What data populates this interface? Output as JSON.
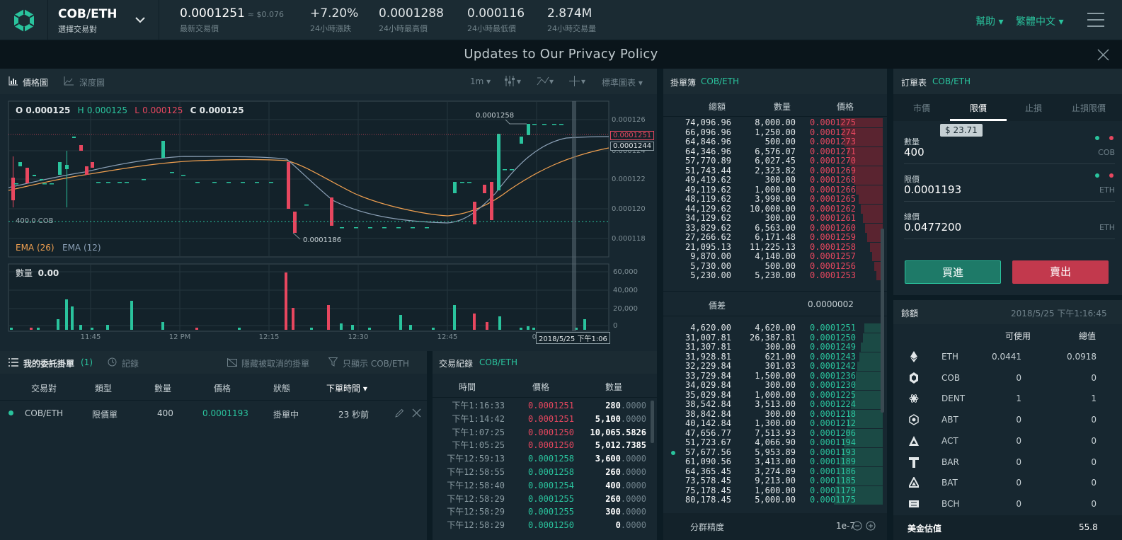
{
  "header": {
    "pair": "COB/ETH",
    "pair_sub": "選擇交易對",
    "last_price": "0.0001251",
    "last_price_usd": "≈ $0.076",
    "last_price_label": "最新交易價",
    "change": "+7.20%",
    "change_label": "24小時漲跌",
    "high": "0.0001288",
    "high_label": "24小時最高價",
    "low": "0.000116",
    "low_label": "24小時最低價",
    "volume": "2.874M",
    "volume_label": "24小時交易量",
    "help": "幫助",
    "language": "繁體中文"
  },
  "banner": {
    "text": "Updates to Our Privacy Policy"
  },
  "chart_panel": {
    "tab_price": "價格圖",
    "tab_depth": "深度圖",
    "interval": "1m",
    "standard": "標準圖表",
    "ohlc": {
      "o_label": "O",
      "o": "0.000125",
      "h_label": "H",
      "h": "0.000125",
      "l_label": "L",
      "l": "0.000125",
      "c_label": "C",
      "c": "0.000125"
    },
    "ema26": "EMA (26)",
    "ema12": "EMA (12)",
    "order_line": "400.0 COB",
    "label_high": "0.0001258",
    "label_low": "0.0001186",
    "last_tag": "0.0001251",
    "ema_tag": "0.0001244",
    "volume_label": "數量",
    "volume_value": "0.00",
    "cursor_time": "2018/5/25 下午1:06"
  },
  "chart_data": {
    "type": "line",
    "price_yticks": [
      "0.000126",
      "0.000124",
      "0.000122",
      "0.000120",
      "0.000118"
    ],
    "volume_yticks": [
      "60,000",
      "40,000",
      "20,000",
      "0"
    ],
    "xticks": [
      "11:45",
      "12 PM",
      "12:15",
      "12:30",
      "12:45",
      "01"
    ],
    "series": [
      {
        "name": "EMA (26)",
        "color": "#f0a050"
      },
      {
        "name": "EMA (12)",
        "color": "#8a9fb5"
      }
    ]
  },
  "orderbook": {
    "title": "掛單簿",
    "pair": "COB/ETH",
    "col_total": "總額",
    "col_amount": "數量",
    "col_price": "價格",
    "spread_label": "價差",
    "spread": "0.0000002",
    "precision_label": "分群精度",
    "precision": "1e-7",
    "asks": [
      [
        "74,096.96",
        "8,000.00",
        "0.0001275"
      ],
      [
        "66,096.96",
        "1,250.00",
        "0.0001274"
      ],
      [
        "64,846.96",
        "500.00",
        "0.0001273"
      ],
      [
        "64,346.96",
        "6,576.07",
        "0.0001271"
      ],
      [
        "57,770.89",
        "6,027.45",
        "0.0001270"
      ],
      [
        "51,743.44",
        "2,323.82",
        "0.0001269"
      ],
      [
        "49,419.62",
        "300.00",
        "0.0001268"
      ],
      [
        "49,119.62",
        "1,000.00",
        "0.0001266"
      ],
      [
        "48,119.62",
        "3,990.00",
        "0.0001265"
      ],
      [
        "44,129.62",
        "10,000.00",
        "0.0001262"
      ],
      [
        "34,129.62",
        "300.00",
        "0.0001261"
      ],
      [
        "33,829.62",
        "6,563.00",
        "0.0001260"
      ],
      [
        "27,266.62",
        "6,171.48",
        "0.0001259"
      ],
      [
        "21,095.13",
        "11,225.13",
        "0.0001258"
      ],
      [
        "9,870.00",
        "4,140.00",
        "0.0001257"
      ],
      [
        "5,730.00",
        "500.00",
        "0.0001256"
      ],
      [
        "5,230.00",
        "5,230.00",
        "0.0001253"
      ]
    ],
    "bids": [
      [
        "4,620.00",
        "4,620.00",
        "0.0001251"
      ],
      [
        "31,007.81",
        "26,387.81",
        "0.0001250"
      ],
      [
        "31,307.81",
        "300.00",
        "0.0001249"
      ],
      [
        "31,928.81",
        "621.00",
        "0.0001243"
      ],
      [
        "32,229.84",
        "301.03",
        "0.0001242"
      ],
      [
        "33,729.84",
        "1,500.00",
        "0.0001236"
      ],
      [
        "34,029.84",
        "300.00",
        "0.0001230"
      ],
      [
        "35,029.84",
        "1,000.00",
        "0.0001225"
      ],
      [
        "38,542.84",
        "3,513.00",
        "0.0001224"
      ],
      [
        "38,842.84",
        "300.00",
        "0.0001218"
      ],
      [
        "40,142.84",
        "1,300.00",
        "0.0001212"
      ],
      [
        "47,656.77",
        "7,513.93",
        "0.0001206"
      ],
      [
        "51,723.67",
        "4,066.90",
        "0.0001194"
      ],
      [
        "57,677.56",
        "5,953.89",
        "0.0001193"
      ],
      [
        "61,090.56",
        "3,413.00",
        "0.0001189"
      ],
      [
        "64,365.45",
        "3,274.89",
        "0.0001186"
      ],
      [
        "73,578.45",
        "9,213.00",
        "0.0001185"
      ],
      [
        "75,178.45",
        "1,600.00",
        "0.0001179"
      ],
      [
        "80,178.45",
        "5,000.00",
        "0.0001175"
      ]
    ]
  },
  "order_form": {
    "title": "訂單表",
    "pair": "COB/ETH",
    "tabs": [
      "市價",
      "限價",
      "止損",
      "止損限價"
    ],
    "tooltip": "$ 23.71",
    "qty_label": "數量",
    "qty": "400",
    "qty_unit": "COB",
    "price_label": "限價",
    "price": "0.0001193",
    "price_unit": "ETH",
    "total_label": "總價",
    "total": "0.0477200",
    "total_unit": "ETH",
    "buy": "買進",
    "sell": "賣出"
  },
  "balances": {
    "title": "餘額",
    "timestamp": "2018/5/25 下午1:16:45",
    "col_available": "可使用",
    "col_total": "總值",
    "rows": [
      {
        "coin": "ETH",
        "available": "0.0441",
        "total": "0.0918"
      },
      {
        "coin": "COB",
        "available": "0",
        "total": "0"
      },
      {
        "coin": "DENT",
        "available": "1",
        "total": "1"
      },
      {
        "coin": "ABT",
        "available": "0",
        "total": "0"
      },
      {
        "coin": "ACT",
        "available": "0",
        "total": "0"
      },
      {
        "coin": "BAR",
        "available": "0",
        "total": "0"
      },
      {
        "coin": "BAT",
        "available": "0",
        "total": "0"
      },
      {
        "coin": "BCH",
        "available": "0",
        "total": "0"
      }
    ],
    "usd_label": "美金估值",
    "usd_value": "55.8"
  },
  "my_orders": {
    "title": "我的委託掛單",
    "count": "(1)",
    "history": "記錄",
    "hide_cancelled": "隱藏被取消的掛單",
    "filter": "只顯示 COB/ETH",
    "cols": [
      "交易對",
      "類型",
      "數量",
      "價格",
      "狀態",
      "下單時間"
    ],
    "rows": [
      {
        "pair": "COB/ETH",
        "type": "限價單",
        "qty": "400",
        "price": "0.0001193",
        "status": "掛單中",
        "time": "23 秒前"
      }
    ]
  },
  "trades": {
    "title": "交易紀錄",
    "pair": "COB/ETH",
    "col_time": "時間",
    "col_price": "價格",
    "col_amount": "數量",
    "rows": [
      {
        "time": "下午1:16:33",
        "price": "0.0001251",
        "side": "sell",
        "amount": "280",
        "dec": ".0000"
      },
      {
        "time": "下午1:14:42",
        "price": "0.0001251",
        "side": "sell",
        "amount": "5,100",
        "dec": ".0000"
      },
      {
        "time": "下午1:07:25",
        "price": "0.0001250",
        "side": "sell",
        "amount": "10,065.5826",
        "dec": ""
      },
      {
        "time": "下午1:05:25",
        "price": "0.0001250",
        "side": "sell",
        "amount": "5,012.7385",
        "dec": ""
      },
      {
        "time": "下午12:59:13",
        "price": "0.0001258",
        "side": "buy",
        "amount": "3,600",
        "dec": ".0000"
      },
      {
        "time": "下午12:58:55",
        "price": "0.0001258",
        "side": "buy",
        "amount": "260",
        "dec": ".0000"
      },
      {
        "time": "下午12:58:40",
        "price": "0.0001254",
        "side": "buy",
        "amount": "400",
        "dec": ".0000"
      },
      {
        "time": "下午12:58:29",
        "price": "0.0001255",
        "side": "buy",
        "amount": "260",
        "dec": ".0000"
      },
      {
        "time": "下午12:58:29",
        "price": "0.0001255",
        "side": "buy",
        "amount": "300",
        "dec": ".0000"
      },
      {
        "time": "下午12:58:29",
        "price": "0.0001250",
        "side": "buy",
        "amount": "0",
        "dec": ".0000"
      }
    ]
  }
}
